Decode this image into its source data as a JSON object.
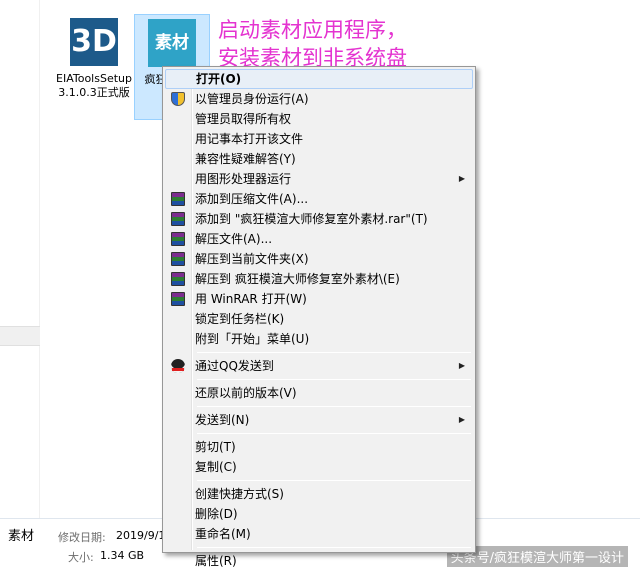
{
  "files": [
    {
      "icon": "3D",
      "name": "EIAToolsSetup3.1.0.3正式版"
    },
    {
      "icon": "素材",
      "name": "疯狂师修复"
    }
  ],
  "annotation": {
    "line1": "启动素材应用程序，",
    "line2": "安装素材到非系统盘"
  },
  "details": {
    "name": "素材",
    "modified_label": "修改日期:",
    "modified_value": "2019/9/18",
    "size_label": "大小:",
    "size_value": "1.34 GB"
  },
  "watermark": "头条号/疯狂模渲大师第一设计",
  "menu": {
    "open": "打开(O)",
    "run_as_admin": "以管理员身份运行(A)",
    "take_ownership": "管理员取得所有权",
    "open_notepad": "用记事本打开该文件",
    "troubleshoot": "兼容性疑难解答(Y)",
    "run_gpu": "用图形处理器运行",
    "add_archive": "添加到压缩文件(A)...",
    "add_rar": "添加到 \"疯狂模渲大师修复室外素材.rar\"(T)",
    "extract_files": "解压文件(A)...",
    "extract_here": "解压到当前文件夹(X)",
    "extract_to": "解压到 疯狂模渲大师修复室外素材\\(E)",
    "open_winrar": "用 WinRAR 打开(W)",
    "pin_taskbar": "锁定到任务栏(K)",
    "pin_start": "附到「开始」菜单(U)",
    "send_qq": "通过QQ发送到",
    "restore": "还原以前的版本(V)",
    "send_to": "发送到(N)",
    "cut": "剪切(T)",
    "copy": "复制(C)",
    "create_shortcut": "创建快捷方式(S)",
    "delete": "删除(D)",
    "rename": "重命名(M)",
    "properties": "属性(R)"
  }
}
